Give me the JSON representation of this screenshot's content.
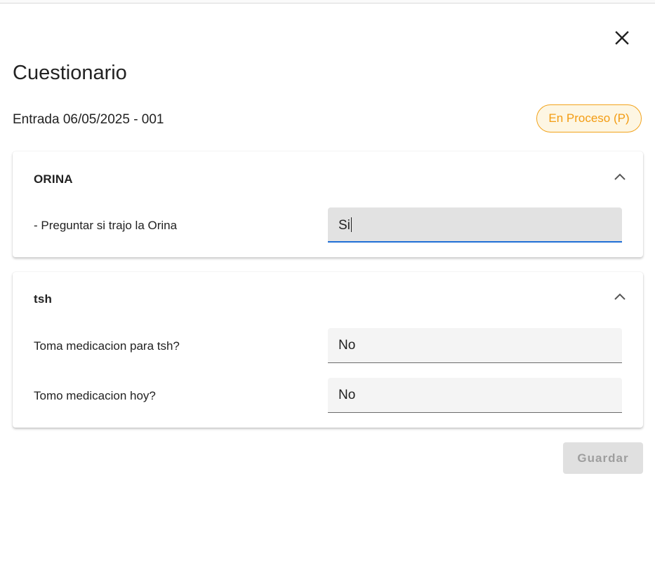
{
  "dialog": {
    "title": "Cuestionario",
    "entry_label": "Entrada 06/05/2025 - 001",
    "status": "En Proceso (P)",
    "status_color": "#f39c12",
    "close_icon": "close-icon"
  },
  "sections": [
    {
      "title": "ORINA",
      "expanded": true,
      "questions": [
        {
          "label": "- Preguntar si trajo la Orina",
          "value": "Si",
          "focused": true
        }
      ]
    },
    {
      "title": "tsh",
      "expanded": true,
      "questions": [
        {
          "label": "Toma medicacion para tsh?",
          "value": "No",
          "focused": false
        },
        {
          "label": "Tomo medicacion hoy?",
          "value": "No",
          "focused": false
        }
      ]
    }
  ],
  "actions": {
    "save_label": "Guardar",
    "save_enabled": false
  },
  "colors": {
    "focus_accent": "#1f6fd6",
    "status_border": "#f2a21a"
  }
}
